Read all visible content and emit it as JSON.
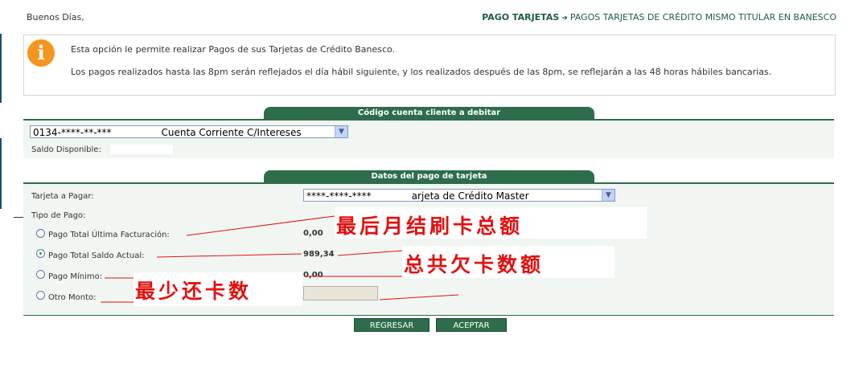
{
  "header": {
    "greeting": "Buenos Días,",
    "breadcrumb_current": "PAGO TARJETAS",
    "breadcrumb_arrow": "➜",
    "breadcrumb_rest": "PAGOS TARJETAS DE CRÉDITO MISMO TITULAR EN BANESCO"
  },
  "info": {
    "icon": "i",
    "line1": "Esta opción le permite realizar Pagos de sus Tarjetas de Crédito Banesco.",
    "line2": "Los pagos realizados hasta las 8pm serán reflejados el día hábil siguiente, y los realizados después de las 8pm, se reflejarán a las 48 horas hábiles bancarias."
  },
  "account_section": {
    "title": "Código cuenta cliente a debitar",
    "account_select_value": "0134-****-**-***",
    "account_select_suffix": "Cuenta Corriente C/Intereses",
    "saldo_label": "Saldo Disponible:"
  },
  "payment_section": {
    "title": "Datos del pago de tarjeta",
    "tarjeta_label": "Tarjeta a Pagar:",
    "tarjeta_select_value": "****-****-****",
    "tarjeta_select_suffix": "arjeta de Crédito Master",
    "tipo_label": "Tipo de Pago:",
    "options": [
      {
        "label": "Pago Total Última Facturación:",
        "value": "0,00",
        "checked": false
      },
      {
        "label": "Pago Total Saldo Actual:",
        "value": "989,34",
        "checked": true
      },
      {
        "label": "Pago Mínimo:",
        "value": "0,00",
        "checked": false
      },
      {
        "label": "Otro Monto:",
        "value": "",
        "checked": false
      }
    ]
  },
  "buttons": {
    "regresar": "REGRESAR",
    "aceptar": "ACEPTAR"
  },
  "annotations": {
    "last_statement_total": "最后月结刷卡总额",
    "total_owed": "总共欠卡数额",
    "minimum_payment": "最少还卡数",
    "color": "#e21111"
  },
  "colors": {
    "brand_green": "#2d6d4b",
    "info_orange": "#f3961f"
  }
}
